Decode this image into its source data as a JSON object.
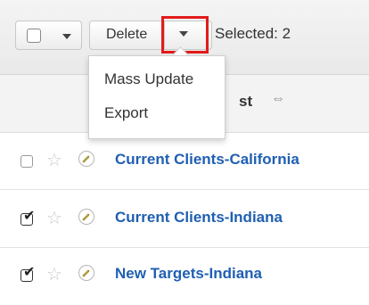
{
  "toolbar": {
    "delete_label": "Delete",
    "selected_text": "Selected: 2"
  },
  "dropdown": {
    "items": [
      "Mass Update",
      "Export"
    ]
  },
  "header": {
    "column_label_fragment": "st",
    "sort_icon": "⇔"
  },
  "rows": [
    {
      "name": "Current Clients-California",
      "checked": false
    },
    {
      "name": "Current Clients-Indiana",
      "checked": true
    },
    {
      "name": "New Targets-Indiana",
      "checked": true
    }
  ],
  "colors": {
    "highlight": "#e21b1b",
    "link": "#1f5fb2"
  }
}
